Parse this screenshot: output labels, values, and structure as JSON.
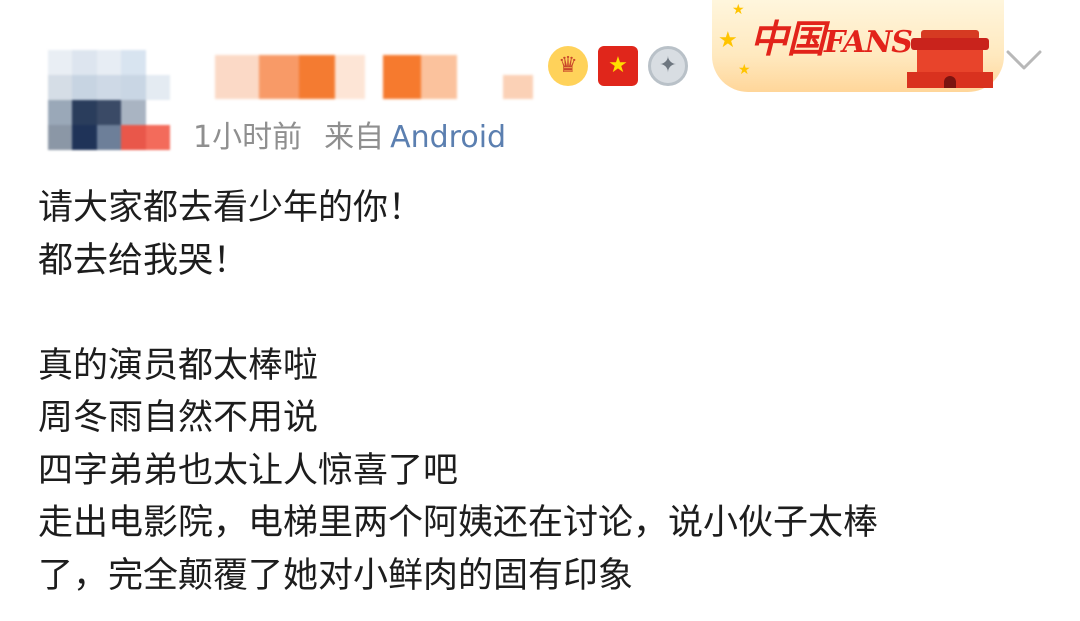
{
  "post": {
    "time": "1小时前",
    "source_prefix": "来自",
    "source_device": "Android",
    "badges": [
      {
        "icon": "crown-icon",
        "color": "#ffd25a"
      },
      {
        "icon": "china-flag-icon",
        "color": "#e0261b"
      },
      {
        "icon": "medal-icon",
        "color": "#d8dde2"
      }
    ],
    "fans_banner": {
      "text_cn": "中国",
      "text_en": "FANS",
      "icon": "tiananmen-gate-icon"
    },
    "content_lines": [
      "请大家都去看少年的你！",
      "都去给我哭！",
      "",
      "真的演员都太棒啦",
      "周冬雨自然不用说",
      "四字弟弟也太让人惊喜了吧",
      "走出电影院，电梯里两个阿姨还在讨论，说小伙子太棒",
      "了，完全颠覆了她对小鲜肉的固有印象"
    ]
  },
  "colors": {
    "meta_gray": "#8f8f8f",
    "link_blue": "#5b7fb0",
    "text": "#1d1d1d",
    "brand_red": "#e2231a"
  }
}
